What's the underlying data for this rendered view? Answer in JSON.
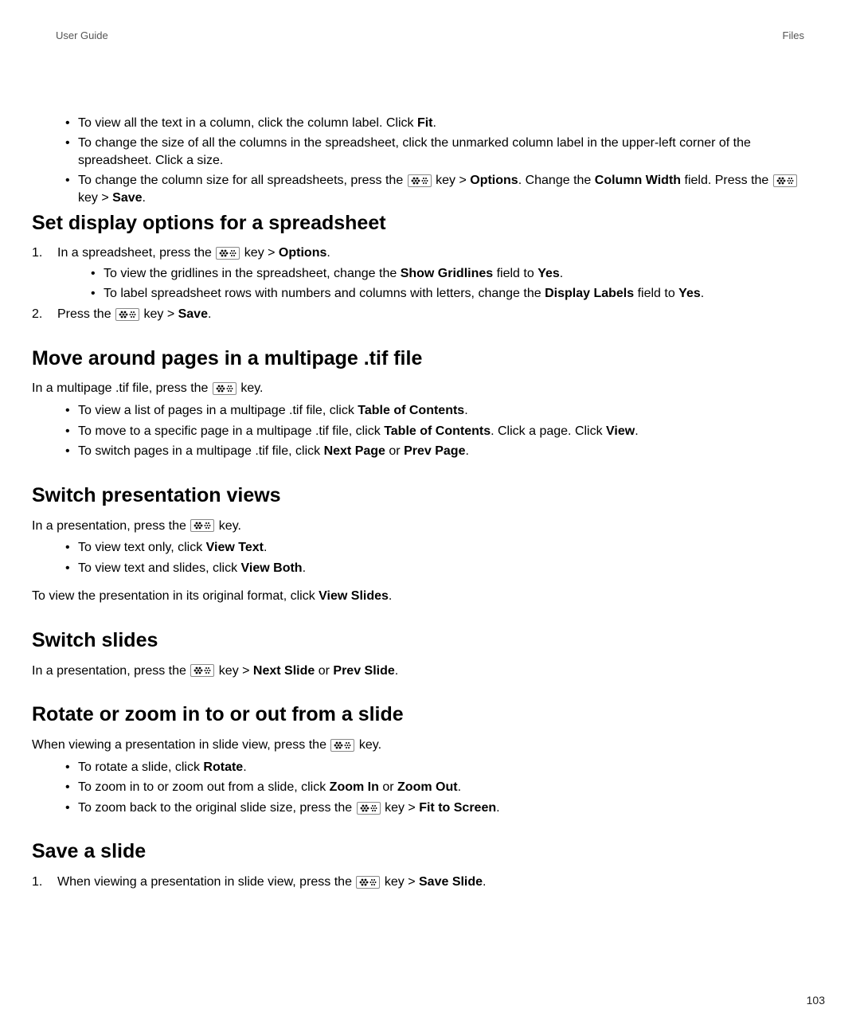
{
  "header": {
    "left": "User Guide",
    "right": "Files"
  },
  "intro_bullets": [
    {
      "parts": [
        {
          "t": "text",
          "v": "To view all the text in a column, click the column label. Click "
        },
        {
          "t": "b",
          "v": "Fit"
        },
        {
          "t": "text",
          "v": "."
        }
      ]
    },
    {
      "parts": [
        {
          "t": "text",
          "v": "To change the size of all the columns in the spreadsheet, click the unmarked column label in the upper-left corner of the spreadsheet. Click a size."
        }
      ]
    },
    {
      "parts": [
        {
          "t": "text",
          "v": "To change the column size for all spreadsheets, press the "
        },
        {
          "t": "key"
        },
        {
          "t": "text",
          "v": " key > "
        },
        {
          "t": "b",
          "v": "Options"
        },
        {
          "t": "text",
          "v": ". Change the "
        },
        {
          "t": "b",
          "v": "Column Width"
        },
        {
          "t": "text",
          "v": " field. Press the "
        },
        {
          "t": "key"
        },
        {
          "t": "text",
          "v": " key > "
        },
        {
          "t": "b",
          "v": "Save"
        },
        {
          "t": "text",
          "v": "."
        }
      ]
    }
  ],
  "sections": [
    {
      "heading": "Set display options for a spreadsheet",
      "ordered": [
        {
          "parts": [
            {
              "t": "text",
              "v": "In a spreadsheet, press the "
            },
            {
              "t": "key"
            },
            {
              "t": "text",
              "v": " key > "
            },
            {
              "t": "b",
              "v": "Options"
            },
            {
              "t": "text",
              "v": "."
            }
          ],
          "sub": [
            {
              "parts": [
                {
                  "t": "text",
                  "v": "To view the gridlines in the spreadsheet, change the "
                },
                {
                  "t": "b",
                  "v": "Show Gridlines"
                },
                {
                  "t": "text",
                  "v": " field to "
                },
                {
                  "t": "b",
                  "v": "Yes"
                },
                {
                  "t": "text",
                  "v": "."
                }
              ]
            },
            {
              "parts": [
                {
                  "t": "text",
                  "v": "To label spreadsheet rows with numbers and columns with letters, change the "
                },
                {
                  "t": "b",
                  "v": "Display Labels"
                },
                {
                  "t": "text",
                  "v": " field to "
                },
                {
                  "t": "b",
                  "v": "Yes"
                },
                {
                  "t": "text",
                  "v": "."
                }
              ]
            }
          ]
        },
        {
          "parts": [
            {
              "t": "text",
              "v": "Press the "
            },
            {
              "t": "key"
            },
            {
              "t": "text",
              "v": " key > "
            },
            {
              "t": "b",
              "v": "Save"
            },
            {
              "t": "text",
              "v": "."
            }
          ]
        }
      ]
    },
    {
      "heading": "Move around pages in a multipage .tif file",
      "intro": {
        "parts": [
          {
            "t": "text",
            "v": "In a multipage .tif file, press the "
          },
          {
            "t": "key"
          },
          {
            "t": "text",
            "v": " key."
          }
        ]
      },
      "bullets": [
        {
          "parts": [
            {
              "t": "text",
              "v": "To view a list of pages in a multipage .tif file, click "
            },
            {
              "t": "b",
              "v": "Table of Contents"
            },
            {
              "t": "text",
              "v": "."
            }
          ]
        },
        {
          "parts": [
            {
              "t": "text",
              "v": "To move to a specific page in a multipage .tif file, click "
            },
            {
              "t": "b",
              "v": "Table of Contents"
            },
            {
              "t": "text",
              "v": ". Click a page. Click "
            },
            {
              "t": "b",
              "v": "View"
            },
            {
              "t": "text",
              "v": "."
            }
          ]
        },
        {
          "parts": [
            {
              "t": "text",
              "v": "To switch pages in a multipage .tif file, click "
            },
            {
              "t": "b",
              "v": "Next Page"
            },
            {
              "t": "text",
              "v": " or "
            },
            {
              "t": "b",
              "v": "Prev Page"
            },
            {
              "t": "text",
              "v": "."
            }
          ]
        }
      ]
    },
    {
      "heading": "Switch presentation views",
      "intro": {
        "parts": [
          {
            "t": "text",
            "v": "In a presentation, press the "
          },
          {
            "t": "key"
          },
          {
            "t": "text",
            "v": " key."
          }
        ]
      },
      "bullets": [
        {
          "parts": [
            {
              "t": "text",
              "v": "To view text only, click "
            },
            {
              "t": "b",
              "v": "View Text"
            },
            {
              "t": "text",
              "v": "."
            }
          ]
        },
        {
          "parts": [
            {
              "t": "text",
              "v": "To view text and slides, click "
            },
            {
              "t": "b",
              "v": "View Both"
            },
            {
              "t": "text",
              "v": "."
            }
          ]
        }
      ],
      "outro": {
        "parts": [
          {
            "t": "text",
            "v": "To view the presentation in its original format, click "
          },
          {
            "t": "b",
            "v": "View Slides"
          },
          {
            "t": "text",
            "v": "."
          }
        ]
      }
    },
    {
      "heading": "Switch slides",
      "intro": {
        "parts": [
          {
            "t": "text",
            "v": "In a presentation, press the "
          },
          {
            "t": "key"
          },
          {
            "t": "text",
            "v": " key > "
          },
          {
            "t": "b",
            "v": "Next Slide"
          },
          {
            "t": "text",
            "v": " or "
          },
          {
            "t": "b",
            "v": "Prev Slide"
          },
          {
            "t": "text",
            "v": "."
          }
        ]
      }
    },
    {
      "heading": "Rotate or zoom in to or out from a slide",
      "intro": {
        "parts": [
          {
            "t": "text",
            "v": "When viewing a presentation in slide view, press the "
          },
          {
            "t": "key"
          },
          {
            "t": "text",
            "v": " key."
          }
        ]
      },
      "bullets": [
        {
          "parts": [
            {
              "t": "text",
              "v": "To rotate a slide, click "
            },
            {
              "t": "b",
              "v": "Rotate"
            },
            {
              "t": "text",
              "v": "."
            }
          ]
        },
        {
          "parts": [
            {
              "t": "text",
              "v": "To zoom in to or zoom out from a slide, click "
            },
            {
              "t": "b",
              "v": "Zoom In"
            },
            {
              "t": "text",
              "v": " or "
            },
            {
              "t": "b",
              "v": "Zoom Out"
            },
            {
              "t": "text",
              "v": "."
            }
          ]
        },
        {
          "parts": [
            {
              "t": "text",
              "v": "To zoom back to the original slide size, press the "
            },
            {
              "t": "key"
            },
            {
              "t": "text",
              "v": " key > "
            },
            {
              "t": "b",
              "v": "Fit to Screen"
            },
            {
              "t": "text",
              "v": "."
            }
          ]
        }
      ]
    },
    {
      "heading": "Save a slide",
      "ordered": [
        {
          "parts": [
            {
              "t": "text",
              "v": "When viewing a presentation in slide view, press the "
            },
            {
              "t": "key"
            },
            {
              "t": "text",
              "v": " key > "
            },
            {
              "t": "b",
              "v": "Save Slide"
            },
            {
              "t": "text",
              "v": "."
            }
          ]
        }
      ]
    }
  ],
  "page_number": "103"
}
